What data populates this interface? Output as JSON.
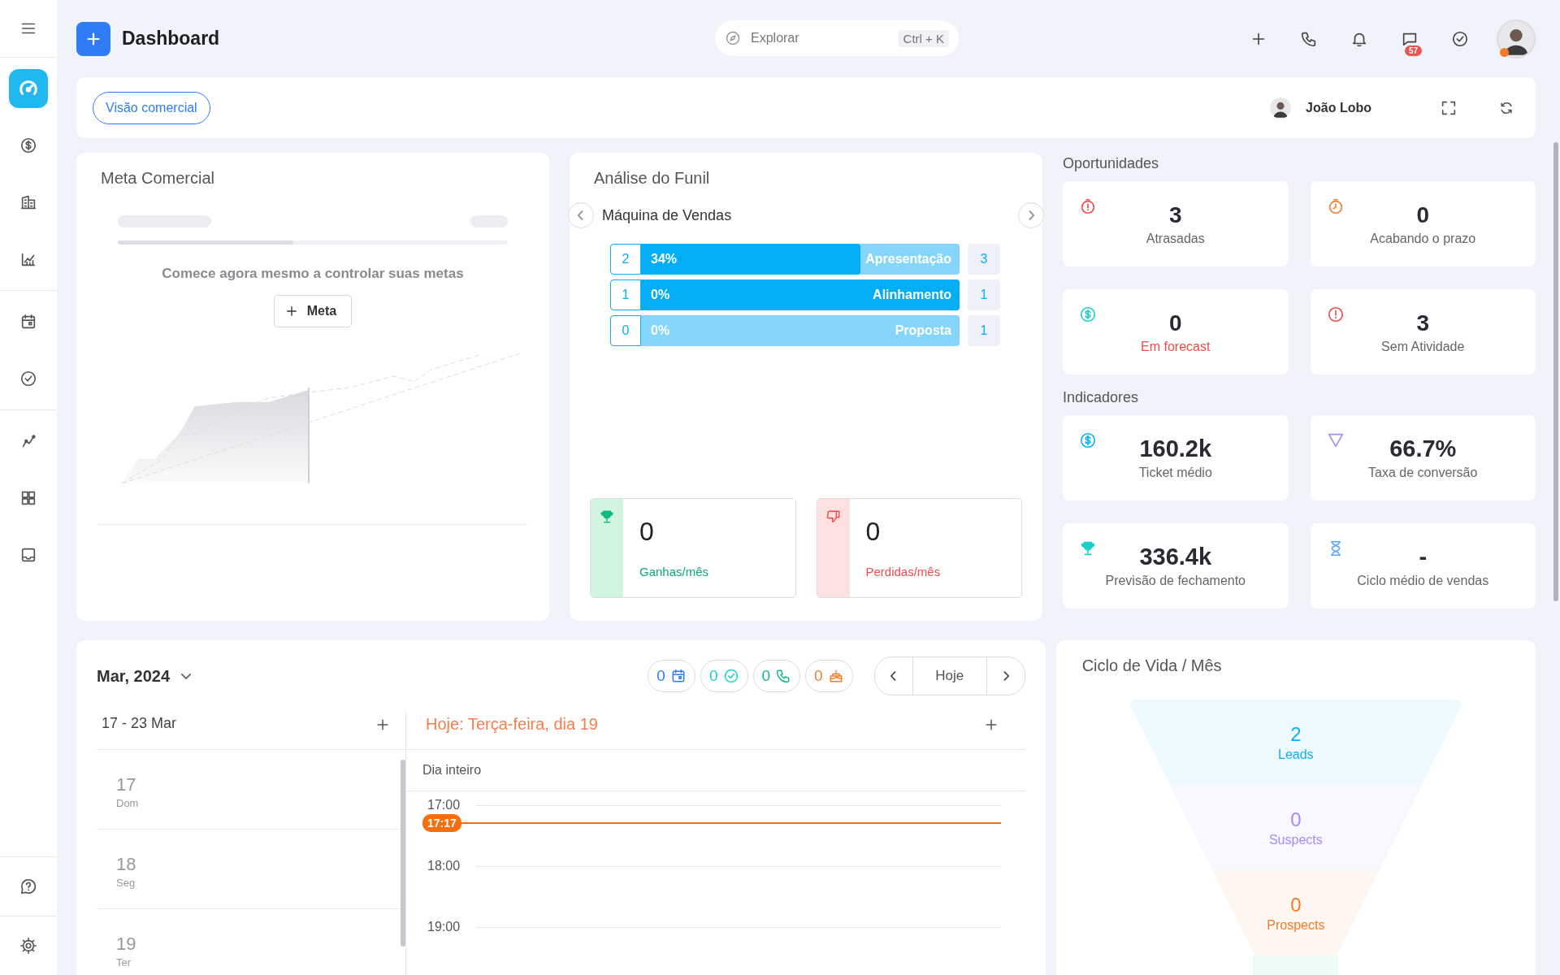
{
  "sidebar": {
    "groups": [
      [
        {
          "selected": true
        },
        {
          "selected": false
        },
        {
          "selected": false
        },
        {
          "selected": false
        }
      ],
      [
        {
          "selected": false
        },
        {
          "selected": false
        }
      ],
      [
        {
          "selected": false
        },
        {
          "selected": false
        },
        {
          "selected": false
        }
      ]
    ],
    "bottom": [
      {
        "selected": false
      },
      {
        "selected": false
      }
    ]
  },
  "topbar": {
    "title": "Dashboard",
    "search": {
      "placeholder": "Explorar",
      "shortcut": "Ctrl + K"
    },
    "messages_badge": "57"
  },
  "header": {
    "view_button": "Visão comercial",
    "user": "João Lobo"
  },
  "meta": {
    "title": "Meta Comercial",
    "message": "Comece agora mesmo a controlar suas metas",
    "button": "Meta"
  },
  "funil": {
    "title": "Análise do Funil",
    "pipeline": "Máquina de Vendas",
    "stages": [
      {
        "count": "2",
        "percent": "34%",
        "name": "Apresentação",
        "level": 0.69,
        "total": "3"
      },
      {
        "count": "1",
        "percent": "0%",
        "name": "Alinhamento",
        "level": 1,
        "total": "1"
      },
      {
        "count": "0",
        "percent": "0%",
        "name": "Proposta",
        "level": 0,
        "total": "1"
      }
    ],
    "results": [
      {
        "kind": "won",
        "value": "0",
        "label": "Ganhas/mês"
      },
      {
        "kind": "lost",
        "value": "0",
        "label": "Perdidas/mês"
      }
    ]
  },
  "oportunidades": {
    "title": "Oportunidades",
    "cards": [
      {
        "color": "#f04b4b",
        "value": "3",
        "label": "Atrasadas",
        "alert": false
      },
      {
        "color": "#f47b2a",
        "value": "0",
        "label": "Acabando o prazo",
        "alert": false
      },
      {
        "color": "#1ccfc9",
        "value": "0",
        "label": "Em forecast",
        "alert": true
      },
      {
        "color": "#f04b4b",
        "value": "3",
        "label": "Sem Atividade",
        "alert": false
      }
    ]
  },
  "indicadores": {
    "title": "Indicadores",
    "cards": [
      {
        "color": "#0ab0f5",
        "value": "160.2k",
        "label": "Ticket médio"
      },
      {
        "color": "#a78bfa",
        "value": "66.7%",
        "label": "Taxa de conversão"
      },
      {
        "color": "#1ccfc9",
        "value": "336.4k",
        "label": "Previsão de fechamento"
      },
      {
        "color": "#60a5fa",
        "value": "-",
        "label": "Ciclo médio de vendas"
      }
    ]
  },
  "calendar": {
    "month": "Mar, 2024",
    "counters": [
      {
        "value": "0",
        "color": "#2f7cf6"
      },
      {
        "value": "0",
        "color": "#1ccfc9"
      },
      {
        "value": "0",
        "color": "#10b981"
      },
      {
        "value": "0",
        "color": "#f47b2a"
      }
    ],
    "today_button": "Hoje",
    "week": "17 - 23 Mar",
    "day_title": "Hoje: Terça-feira, dia 19",
    "all_day": "Dia inteiro",
    "days": [
      {
        "day": "17",
        "weekday": "Dom"
      },
      {
        "day": "18",
        "weekday": "Seg"
      },
      {
        "day": "19",
        "weekday": "Ter"
      }
    ],
    "hours": [
      "17:00",
      "18:00",
      "19:00"
    ],
    "now": "17:17"
  },
  "ciclo": {
    "title": "Ciclo de Vida / Mês",
    "stages": [
      {
        "value": "2",
        "label": "Leads",
        "color": "#0ab0f5"
      },
      {
        "value": "0",
        "label": "Suspects",
        "color": "#a78bfa"
      },
      {
        "value": "0",
        "label": "Prospects",
        "color": "#f47b2a"
      }
    ]
  }
}
